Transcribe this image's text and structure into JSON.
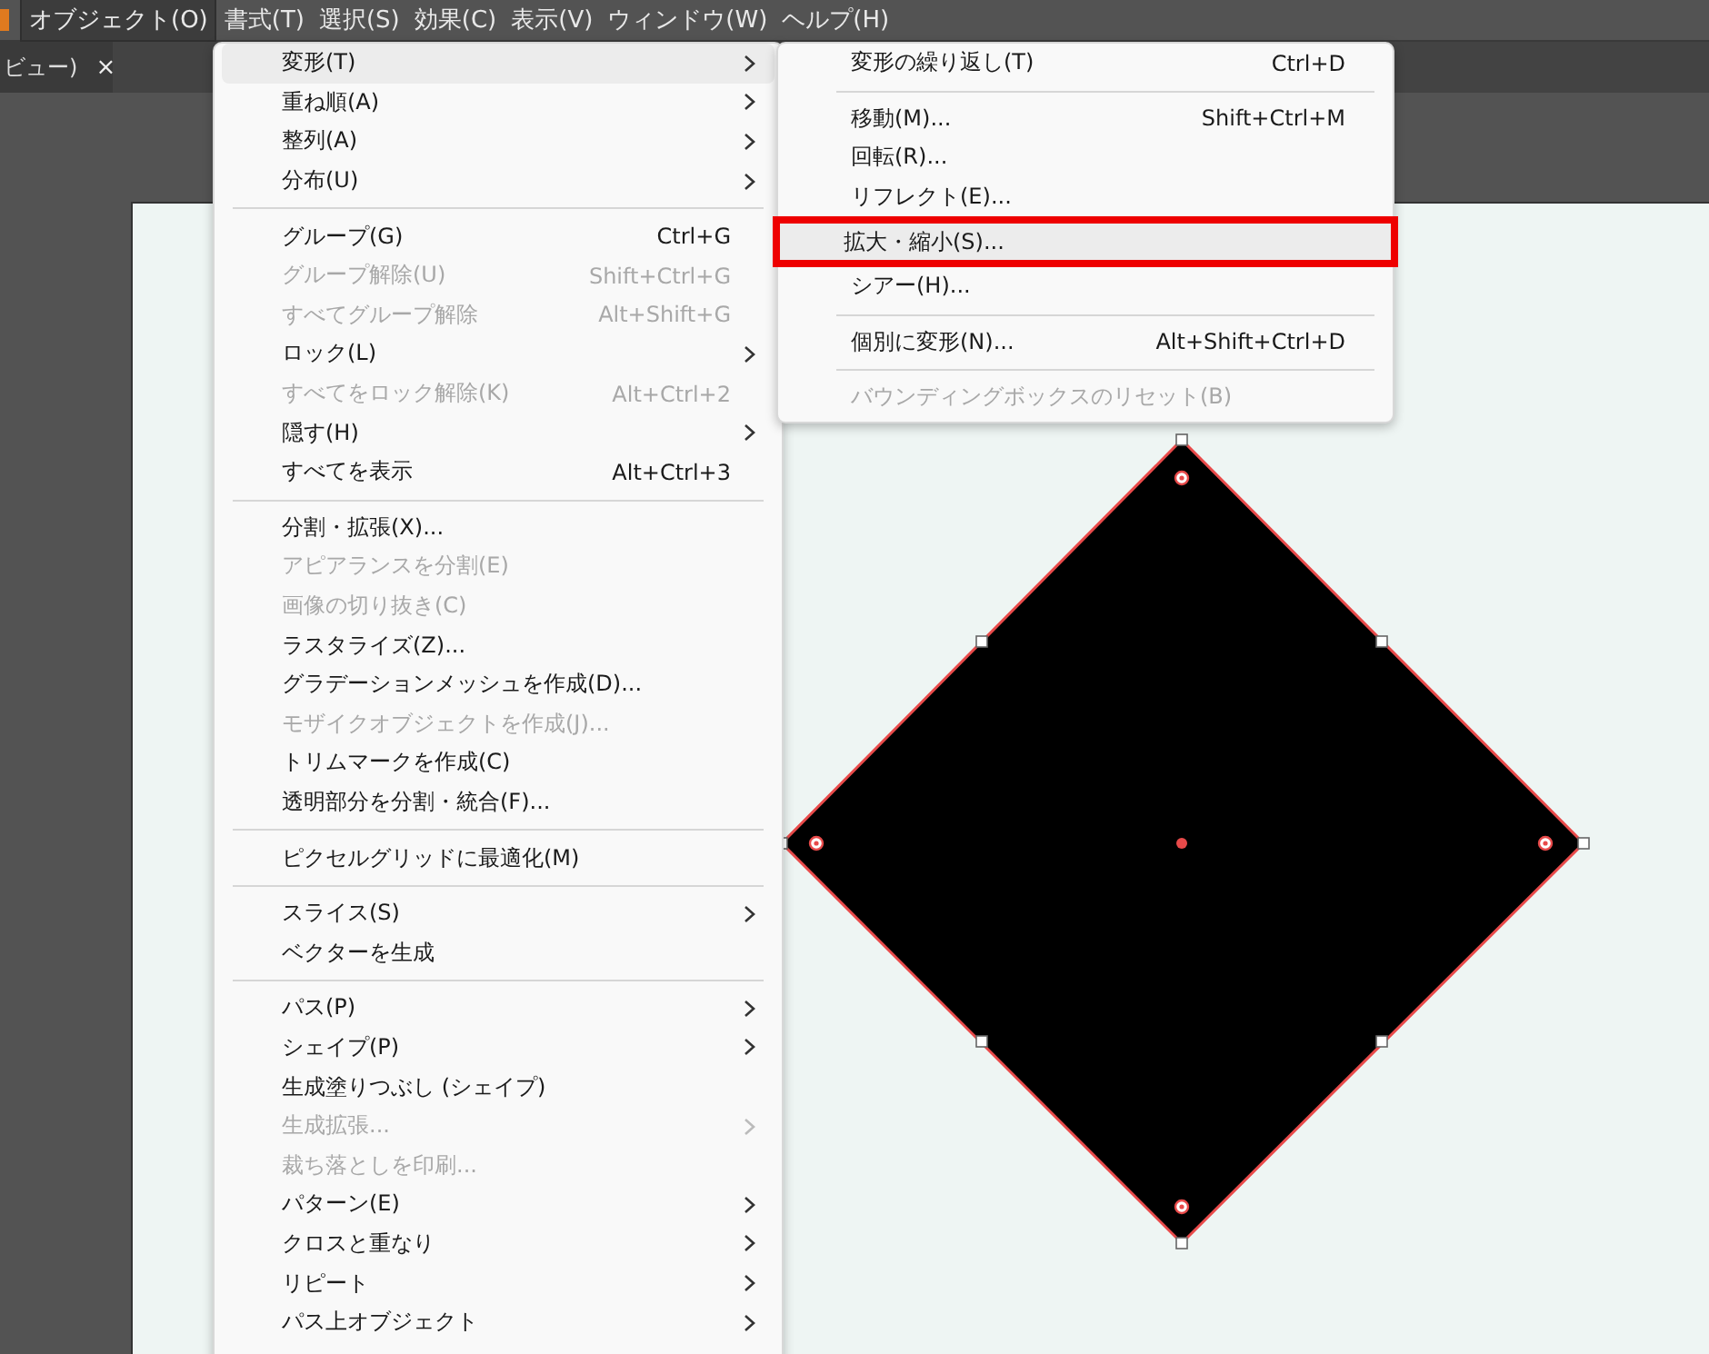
{
  "menubar": [
    {
      "label": "オブジェクト(O)",
      "selected": true
    },
    {
      "label": "書式(T)",
      "selected": false
    },
    {
      "label": "選択(S)",
      "selected": false
    },
    {
      "label": "効果(C)",
      "selected": false
    },
    {
      "label": "表示(V)",
      "selected": false
    },
    {
      "label": "ウィンドウ(W)",
      "selected": false
    },
    {
      "label": "ヘルプ(H)",
      "selected": false
    }
  ],
  "document_tab": {
    "title": "ビュー)",
    "close": "×"
  },
  "object_menu": [
    {
      "kind": "item",
      "label": "変形(T)",
      "submenu": true,
      "disabled": false,
      "selected": true
    },
    {
      "kind": "item",
      "label": "重ね順(A)",
      "submenu": true,
      "disabled": false,
      "selected": false
    },
    {
      "kind": "item",
      "label": "整列(A)",
      "submenu": true,
      "disabled": false,
      "selected": false
    },
    {
      "kind": "item",
      "label": "分布(U)",
      "submenu": true,
      "disabled": false,
      "selected": false
    },
    {
      "kind": "separator"
    },
    {
      "kind": "item",
      "label": "グループ(G)",
      "shortcut": "Ctrl+G",
      "submenu": false,
      "disabled": false,
      "selected": false
    },
    {
      "kind": "item",
      "label": "グループ解除(U)",
      "shortcut": "Shift+Ctrl+G",
      "submenu": false,
      "disabled": true,
      "selected": false
    },
    {
      "kind": "item",
      "label": "すべてグループ解除",
      "shortcut": "Alt+Shift+G",
      "submenu": false,
      "disabled": true,
      "selected": false
    },
    {
      "kind": "item",
      "label": "ロック(L)",
      "submenu": true,
      "disabled": false,
      "selected": false
    },
    {
      "kind": "item",
      "label": "すべてをロック解除(K)",
      "shortcut": "Alt+Ctrl+2",
      "submenu": false,
      "disabled": true,
      "selected": false
    },
    {
      "kind": "item",
      "label": "隠す(H)",
      "submenu": true,
      "disabled": false,
      "selected": false
    },
    {
      "kind": "item",
      "label": "すべてを表示",
      "shortcut": "Alt+Ctrl+3",
      "submenu": false,
      "disabled": false,
      "selected": false
    },
    {
      "kind": "separator"
    },
    {
      "kind": "item",
      "label": "分割・拡張(X)...",
      "submenu": false,
      "disabled": false,
      "selected": false
    },
    {
      "kind": "item",
      "label": "アピアランスを分割(E)",
      "submenu": false,
      "disabled": true,
      "selected": false
    },
    {
      "kind": "item",
      "label": "画像の切り抜き(C)",
      "submenu": false,
      "disabled": true,
      "selected": false
    },
    {
      "kind": "item",
      "label": "ラスタライズ(Z)...",
      "submenu": false,
      "disabled": false,
      "selected": false
    },
    {
      "kind": "item",
      "label": "グラデーションメッシュを作成(D)...",
      "submenu": false,
      "disabled": false,
      "selected": false
    },
    {
      "kind": "item",
      "label": "モザイクオブジェクトを作成(J)...",
      "submenu": false,
      "disabled": true,
      "selected": false
    },
    {
      "kind": "item",
      "label": "トリムマークを作成(C)",
      "submenu": false,
      "disabled": false,
      "selected": false
    },
    {
      "kind": "item",
      "label": "透明部分を分割・統合(F)...",
      "submenu": false,
      "disabled": false,
      "selected": false
    },
    {
      "kind": "separator"
    },
    {
      "kind": "item",
      "label": "ピクセルグリッドに最適化(M)",
      "submenu": false,
      "disabled": false,
      "selected": false
    },
    {
      "kind": "separator"
    },
    {
      "kind": "item",
      "label": "スライス(S)",
      "submenu": true,
      "disabled": false,
      "selected": false
    },
    {
      "kind": "item",
      "label": "ベクターを生成",
      "submenu": false,
      "disabled": false,
      "selected": false
    },
    {
      "kind": "separator"
    },
    {
      "kind": "item",
      "label": "パス(P)",
      "submenu": true,
      "disabled": false,
      "selected": false
    },
    {
      "kind": "item",
      "label": "シェイプ(P)",
      "submenu": true,
      "disabled": false,
      "selected": false
    },
    {
      "kind": "item",
      "label": "生成塗りつぶし (シェイプ)",
      "submenu": false,
      "disabled": false,
      "selected": false
    },
    {
      "kind": "item",
      "label": "生成拡張...",
      "submenu": true,
      "disabled": true,
      "selected": false
    },
    {
      "kind": "item",
      "label": "裁ち落としを印刷...",
      "submenu": false,
      "disabled": true,
      "selected": false
    },
    {
      "kind": "item",
      "label": "パターン(E)",
      "submenu": true,
      "disabled": false,
      "selected": false
    },
    {
      "kind": "item",
      "label": "クロスと重なり",
      "submenu": true,
      "disabled": false,
      "selected": false
    },
    {
      "kind": "item",
      "label": "リピート",
      "submenu": true,
      "disabled": false,
      "selected": false
    },
    {
      "kind": "item",
      "label": "パス上オブジェクト",
      "submenu": true,
      "disabled": false,
      "selected": false
    }
  ],
  "transform_submenu": [
    {
      "kind": "item",
      "label": "変形の繰り返し(T)",
      "shortcut": "Ctrl+D",
      "disabled": false,
      "selected": false,
      "outlined": false
    },
    {
      "kind": "separator"
    },
    {
      "kind": "item",
      "label": "移動(M)...",
      "shortcut": "Shift+Ctrl+M",
      "disabled": false,
      "selected": false,
      "outlined": false
    },
    {
      "kind": "item",
      "label": "回転(R)...",
      "disabled": false,
      "selected": false,
      "outlined": false
    },
    {
      "kind": "item",
      "label": "リフレクト(E)...",
      "disabled": false,
      "selected": false,
      "outlined": false
    },
    {
      "kind": "item",
      "label": "拡大・縮小(S)...",
      "disabled": false,
      "selected": true,
      "outlined": true
    },
    {
      "kind": "item",
      "label": "シアー(H)...",
      "disabled": false,
      "selected": false,
      "outlined": false
    },
    {
      "kind": "separator"
    },
    {
      "kind": "item",
      "label": "個別に変形(N)...",
      "shortcut": "Alt+Shift+Ctrl+D",
      "disabled": false,
      "selected": false,
      "outlined": false
    },
    {
      "kind": "separator"
    },
    {
      "kind": "item",
      "label": "バウンディングボックスのリセット(B)",
      "disabled": true,
      "selected": false,
      "outlined": false
    }
  ]
}
